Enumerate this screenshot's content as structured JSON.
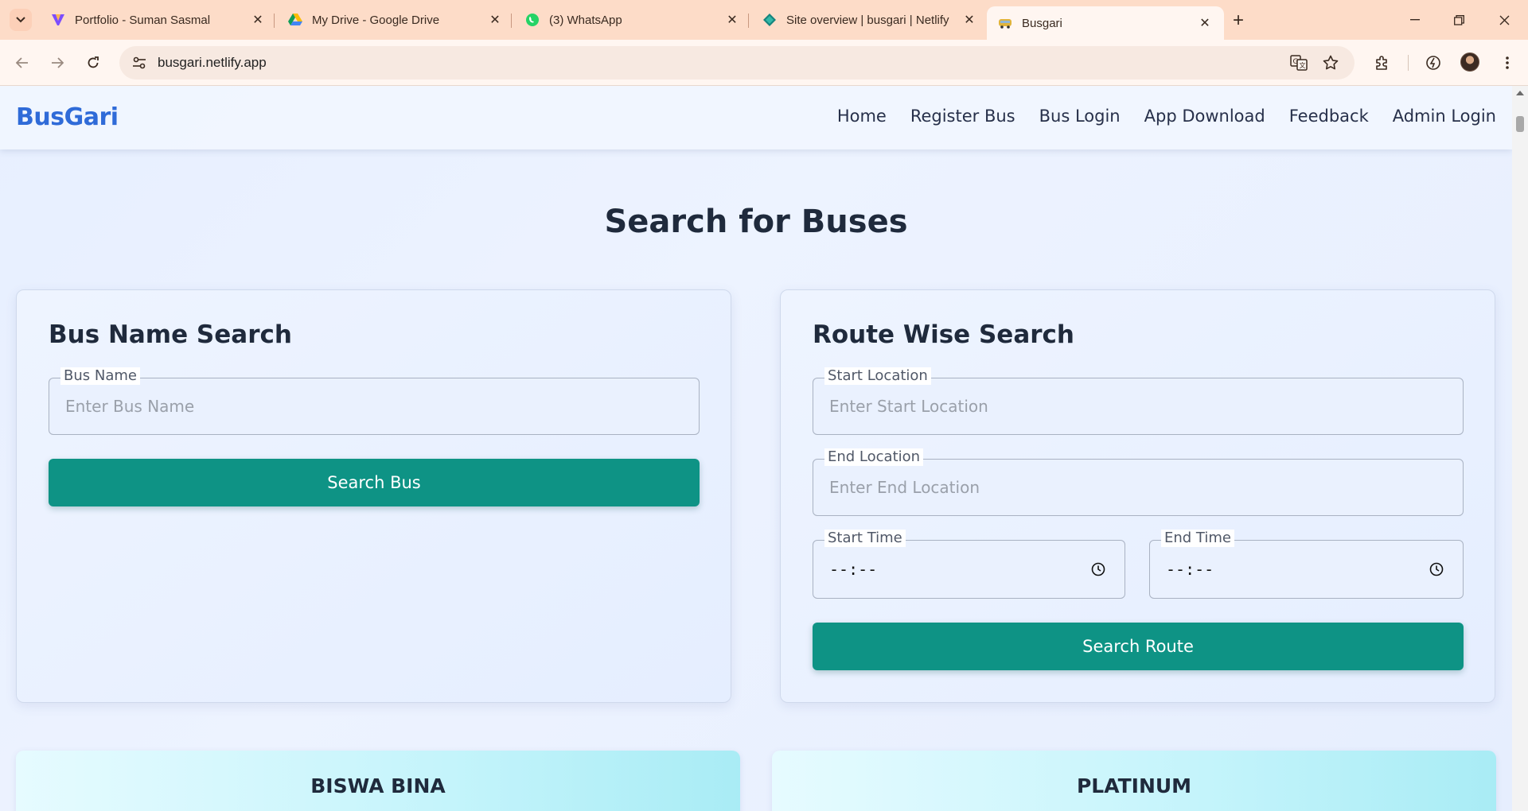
{
  "browser": {
    "tabs": [
      {
        "title": "Portfolio - Suman Sasmal",
        "icon": "portfolio-v-icon"
      },
      {
        "title": "My Drive - Google Drive",
        "icon": "google-drive-icon"
      },
      {
        "title": "(3) WhatsApp",
        "icon": "whatsapp-icon"
      },
      {
        "title": "Site overview | busgari | Netlify",
        "icon": "netlify-icon"
      },
      {
        "title": "Busgari",
        "icon": "busgari-favicon",
        "active": true
      }
    ],
    "url": "busgari.netlify.app"
  },
  "site": {
    "brand": "BusGari",
    "nav": [
      "Home",
      "Register Bus",
      "Bus Login",
      "App Download",
      "Feedback",
      "Admin Login"
    ],
    "title": "Search for Buses",
    "bus_search": {
      "heading": "Bus Name Search",
      "field_label": "Bus Name",
      "placeholder": "Enter Bus Name",
      "button": "Search Bus"
    },
    "route_search": {
      "heading": "Route Wise Search",
      "start_label": "Start Location",
      "start_placeholder": "Enter Start Location",
      "end_label": "End Location",
      "end_placeholder": "Enter End Location",
      "start_time_label": "Start Time",
      "start_time_value": "--:--",
      "end_time_label": "End Time",
      "end_time_value": "--:--",
      "button": "Search Route"
    },
    "buses": [
      "BISWA BINA",
      "PLATINUM"
    ]
  },
  "colors": {
    "brand": "#2f6bd8",
    "button": "#0e9385"
  }
}
